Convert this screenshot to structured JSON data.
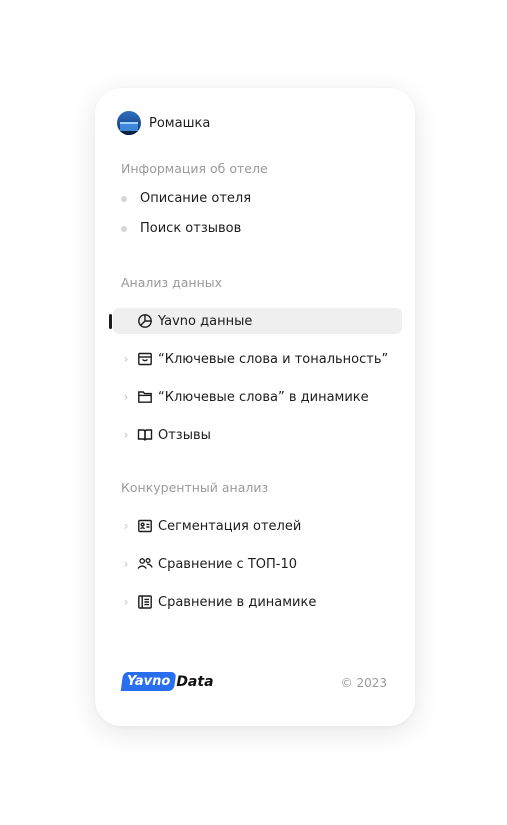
{
  "user": {
    "name": "Ромашка"
  },
  "hotel_info": {
    "title": "Информация об отеле",
    "items": [
      {
        "label": "Описание отеля"
      },
      {
        "label": "Поиск отзывов"
      }
    ]
  },
  "data_analysis": {
    "title": "Анализ данных",
    "items": [
      {
        "label": "Yavno данные",
        "icon": "pie-chart-icon",
        "active": true
      },
      {
        "label": "“Ключевые слова и тональность”",
        "icon": "inbox-icon"
      },
      {
        "label": "“Ключевые слова” в динамике",
        "icon": "folder-icon"
      },
      {
        "label": "Отзывы",
        "icon": "book-open-icon"
      }
    ]
  },
  "competitive_analysis": {
    "title": "Конкурентный анализ",
    "items": [
      {
        "label": "Сегментация отелей",
        "icon": "id-card-icon"
      },
      {
        "label": "Сравнение с ТОП-10",
        "icon": "users-icon"
      },
      {
        "label": "Сравнение в динамике",
        "icon": "newspaper-icon"
      }
    ]
  },
  "footer": {
    "logo_part1": "Yavno",
    "logo_part2": "Data",
    "copyright": "© 2023"
  },
  "colors": {
    "accent": "#2a6ef0",
    "active_bg": "#efefef",
    "muted_text": "#9a9a9a"
  }
}
